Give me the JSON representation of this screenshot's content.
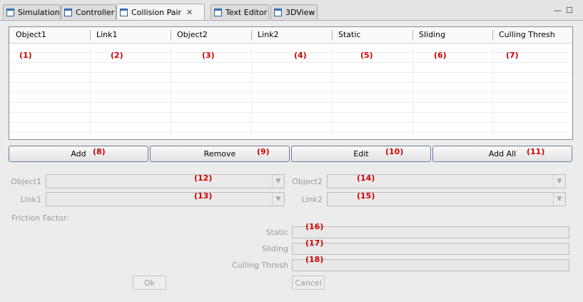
{
  "tabs": [
    {
      "label": "Simulation",
      "active": false
    },
    {
      "label": "Controller",
      "active": false
    },
    {
      "label": "Collision Pair",
      "active": true
    },
    {
      "label": "Text Editor",
      "active": false
    },
    {
      "label": "3DView",
      "active": false
    }
  ],
  "window_controls": {
    "minimize": "—",
    "maximize": "☐"
  },
  "table": {
    "columns": [
      "Object1",
      "Link1",
      "Object2",
      "Link2",
      "Static",
      "Sliding",
      "Culling Thresh"
    ],
    "rows": []
  },
  "buttons": {
    "add": "Add",
    "remove": "Remove",
    "edit": "Edit",
    "add_all": "Add All"
  },
  "form": {
    "object1_label": "Object1",
    "link1_label": "Link1",
    "object2_label": "Object2",
    "link2_label": "Link2",
    "friction_label": "Friction Factor:",
    "static_label": "Static",
    "sliding_label": "Sliding",
    "culling_label": "Culling Thresh",
    "ok": "Ok",
    "cancel": "Cancel"
  },
  "annotations": [
    "(1)",
    "(2)",
    "(3)",
    "(4)",
    "(5)",
    "(6)",
    "(7)",
    "(8)",
    "(9)",
    "(10)",
    "(11)",
    "(12)",
    "(13)",
    "(14)",
    "(15)",
    "(16)",
    "(17)",
    "(18)"
  ]
}
